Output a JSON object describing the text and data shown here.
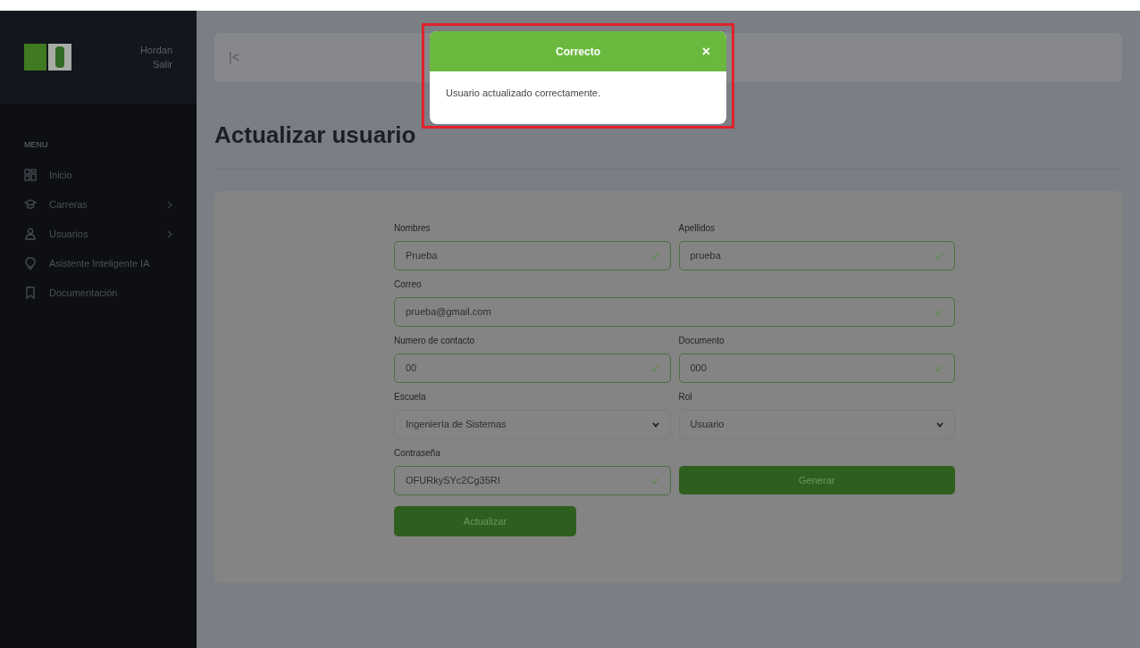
{
  "sidebar": {
    "user": {
      "name": "Hordan",
      "logout": "Salir"
    },
    "menu_heading": "MENU",
    "items": [
      {
        "label": "Inicio",
        "has_submenu": false
      },
      {
        "label": "Carreras",
        "has_submenu": true
      },
      {
        "label": "Usuarios",
        "has_submenu": true
      },
      {
        "label": "Asistente Inteligente IA",
        "has_submenu": false
      },
      {
        "label": "Documentación",
        "has_submenu": false
      }
    ]
  },
  "topbar": {
    "collapse_icon": "|<"
  },
  "page_title": "Actualizar usuario",
  "form": {
    "rows": [
      [
        {
          "kind": "text",
          "label": "Nombres",
          "value": "Prueba",
          "valid": true
        },
        {
          "kind": "text",
          "label": "Apellidos",
          "value": "prueba",
          "valid": true
        }
      ],
      [
        {
          "kind": "text",
          "label": "Correo",
          "value": "prueba@gmail.com",
          "valid": true
        }
      ],
      [
        {
          "kind": "text",
          "label": "Numero de contacto",
          "value": "00",
          "valid": true
        },
        {
          "kind": "text",
          "label": "Documento",
          "value": "000",
          "valid": true
        }
      ],
      [
        {
          "kind": "select",
          "label": "Escuela",
          "value": "Ingeniería de Sistemas"
        },
        {
          "kind": "select",
          "label": "Rol",
          "value": "Usuario"
        }
      ],
      [
        {
          "kind": "text",
          "label": "Contraseña",
          "value": "OFURkySYc2Cg35RI",
          "valid": true
        },
        {
          "kind": "button",
          "label": "Generar"
        }
      ]
    ],
    "submit": "Actualizar"
  },
  "toast": {
    "title": "Correcto",
    "close": "×",
    "message": "Usuario actualizado correctamente.",
    "highlighted": true
  }
}
